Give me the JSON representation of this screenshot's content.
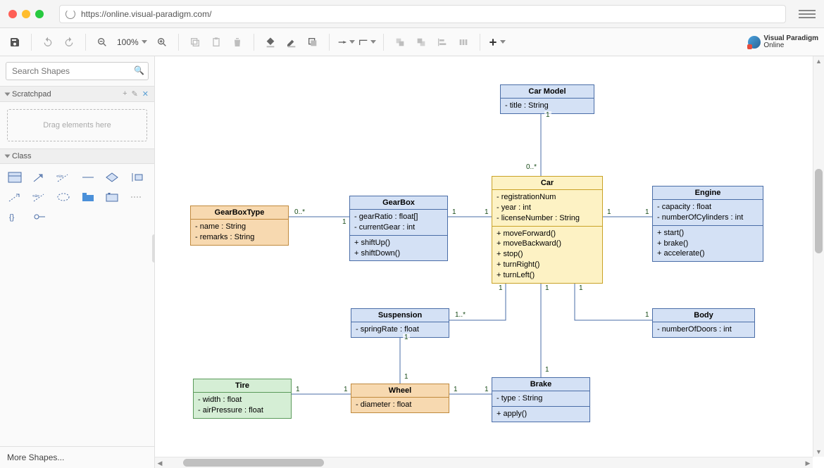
{
  "url": "https://online.visual-paradigm.com/",
  "toolbar": {
    "zoom": "100%"
  },
  "logo": {
    "line1": "Visual Paradigm",
    "line2": "Online"
  },
  "sidebar": {
    "searchPlaceholder": "Search Shapes",
    "scratchpad": {
      "title": "Scratchpad",
      "hint": "Drag elements here"
    },
    "classSection": "Class",
    "moreShapes": "More Shapes..."
  },
  "uml": {
    "carModel": {
      "name": "Car Model",
      "attrs": [
        "- title : String"
      ]
    },
    "car": {
      "name": "Car",
      "attrs": [
        "- registrationNum",
        "- year : int",
        "- licenseNumber : String"
      ],
      "ops": [
        "+ moveForward()",
        "+ moveBackward()",
        "+ stop()",
        "+ turnRight()",
        "+ turnLeft()"
      ]
    },
    "engine": {
      "name": "Engine",
      "attrs": [
        "- capacity : float",
        "- numberOfCylinders : int"
      ],
      "ops": [
        "+ start()",
        "+ brake()",
        "+ accelerate()"
      ]
    },
    "gearBox": {
      "name": "GearBox",
      "attrs": [
        "- gearRatio : float[]",
        "- currentGear : int"
      ],
      "ops": [
        "+ shiftUp()",
        "+ shiftDown()"
      ]
    },
    "gearBoxType": {
      "name": "GearBoxType",
      "attrs": [
        "- name : String",
        "- remarks : String"
      ]
    },
    "suspension": {
      "name": "Suspension",
      "attrs": [
        "- springRate : float"
      ]
    },
    "body": {
      "name": "Body",
      "attrs": [
        "- numberOfDoors : int"
      ]
    },
    "brake": {
      "name": "Brake",
      "attrs": [
        "- type : String"
      ],
      "ops": [
        "+ apply()"
      ]
    },
    "wheel": {
      "name": "Wheel",
      "attrs": [
        "- diameter : float"
      ]
    },
    "tire": {
      "name": "Tire",
      "attrs": [
        "- width : float",
        "- airPressure : float"
      ]
    }
  },
  "multiplicities": {
    "carModel_car_top": "1",
    "carModel_car_bottom": "0..*",
    "gearBoxType_gearBox_left": "0..*",
    "gearBoxType_gearBox_right": "1",
    "gearBox_car_left": "1",
    "gearBox_car_right": "1",
    "car_engine_left": "1",
    "car_engine_right": "1",
    "car_suspension_top": "1",
    "car_suspension_right": "1..*",
    "suspension_wheel_top": "1",
    "suspension_wheel_bottom": "1",
    "car_brake_top": "1",
    "car_brake_bottom": "1",
    "car_body_top": "1",
    "car_body_bottom": "1",
    "wheel_brake_left": "1",
    "wheel_brake_right": "1",
    "tire_wheel_left": "1",
    "tire_wheel_right": "1"
  }
}
